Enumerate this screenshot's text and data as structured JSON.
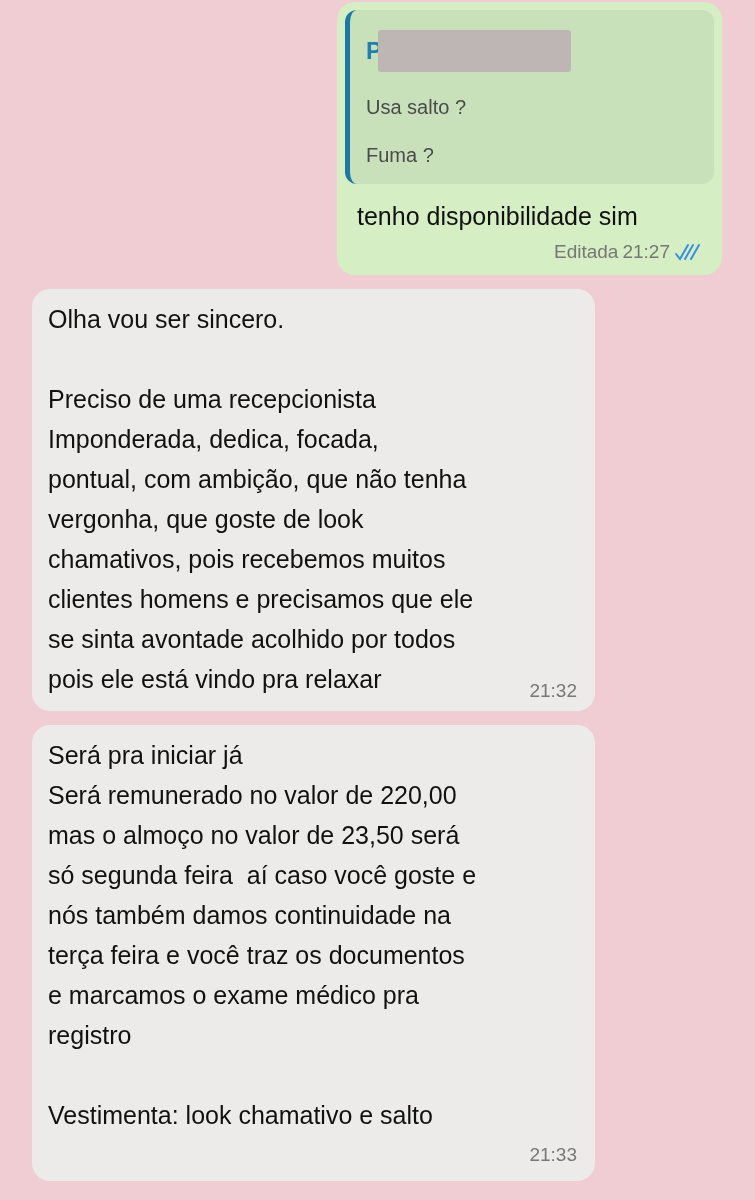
{
  "messages": [
    {
      "kind": "outgoing",
      "quote": {
        "author": "P",
        "redacted": true,
        "paragraphs": [
          "Usa salto ?",
          "Fuma ?"
        ]
      },
      "paragraphs": [
        [
          "tenho disponibilidade sim"
        ]
      ],
      "edited_label": "Editada",
      "time": "21:27",
      "read": true
    },
    {
      "kind": "incoming",
      "paragraphs": [
        [
          "Olha vou ser sincero."
        ],
        [
          "Preciso de uma recepcionista",
          "Imponderada, dedica, focada,",
          "pontual, com ambição, que não tenha",
          "vergonha, que goste de look",
          "chamativos, pois recebemos muitos",
          "clientes homens e precisamos que ele",
          "se sinta avontade acolhido por todos",
          "pois ele está vindo pra relaxar"
        ]
      ],
      "time": "21:32",
      "time_inline": true
    },
    {
      "kind": "incoming",
      "paragraphs": [
        [
          "Será pra iniciar já",
          "Será remunerado no valor de 220,00",
          "mas o almoço no valor de 23,50 será",
          "só segunda feira  aí caso você goste e",
          "nós também damos continuidade na",
          "terça feira e você traz os documentos",
          "e marcamos o exame médico pra",
          "registro"
        ],
        [
          "Vestimenta: look chamativo e salto"
        ]
      ],
      "time": "21:33",
      "time_inline": false
    }
  ]
}
